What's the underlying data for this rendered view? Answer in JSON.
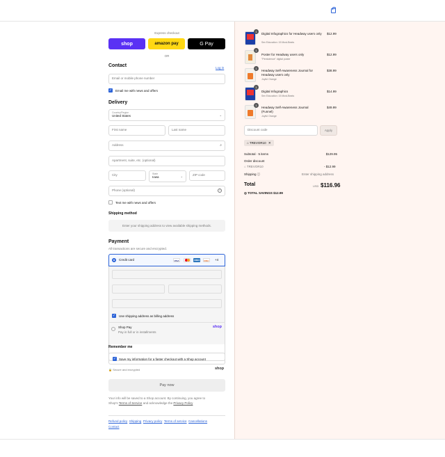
{
  "express": {
    "label": "Express checkout",
    "shop_label": "shop",
    "amazon_label": "amazon pay",
    "gpay_label": "G Pay",
    "or_label": "OR"
  },
  "contact": {
    "title": "Contact",
    "login_label": "Log in",
    "input_placeholder": "Email or mobile phone number",
    "news_label": "Email me with news and offers"
  },
  "delivery": {
    "title": "Delivery",
    "country_label": "Country/Region",
    "country_value": "United States",
    "first_name": "First name",
    "last_name": "Last name",
    "address": "Address",
    "apartment": "Apartment, suite, etc. (optional)",
    "city": "City",
    "state_label": "State",
    "state_value": "Iowa",
    "zip": "ZIP code",
    "phone": "Phone (optional)",
    "text_news_label": "Text me with news and offers"
  },
  "shipping_method": {
    "title": "Shipping method",
    "message": "Enter your shipping address to view available shipping methods."
  },
  "payment": {
    "title": "Payment",
    "subtitle": "All transactions are secure and encrypted.",
    "credit_card_label": "Credit card",
    "card_more": "+4",
    "billing_label": "Use shipping address as billing address",
    "shoppay_label": "Shop Pay",
    "shoppay_sub": "Pay in full or in installments",
    "shoppay_logo": "shop"
  },
  "remember": {
    "title": "Remember me",
    "save_label": "Save my information for a faster checkout with a Shop account",
    "secure_label": "Secure and encrypted",
    "shop_logo": "shop"
  },
  "pay_now": "Pay now",
  "disclaimer": {
    "line1": "Your info will be saved to a Shop account. By continuing, you agree to",
    "line2_a": "Shop's",
    "tos": "Terms of Service",
    "line2_b": "and acknowledge the",
    "privacy": "Privacy Policy"
  },
  "footer_links": [
    "Refund policy",
    "Shipping",
    "Privacy policy",
    "Terms of service",
    "Cancellations",
    "Contact"
  ],
  "order": {
    "items": [
      {
        "qty": "1",
        "name_1": "Digital Infographics for Headway users",
        "name_2": "only",
        "variant": "Sex Education: 15 Most-Beats",
        "price": "$12.99",
        "thumb": "book-blue"
      },
      {
        "qty": "1",
        "name_1": "Poster for Headway users only",
        "name_2": "",
        "variant": "\"Persistence\" digital poster",
        "price": "$12.99",
        "thumb": "poster"
      },
      {
        "qty": "1",
        "name_1": "Headway Self-Awareness Journal for",
        "name_2": "Headway users only",
        "variant": "Joyful Orange",
        "price": "$38.99",
        "thumb": "journal"
      },
      {
        "qty": "1",
        "name_1": "Digital Infographics",
        "name_2": "",
        "variant": "Sex Education: 15 Most-Beats",
        "price": "$14.99",
        "thumb": "book-blue"
      },
      {
        "qty": "1",
        "name_1": "Headway Self-Awareness Journal",
        "name_2": "(Funnel)",
        "variant": "Joyful Orange",
        "price": "$49.99",
        "thumb": "journal"
      }
    ],
    "discount_placeholder": "Discount code",
    "apply_label": "Apply",
    "code_tag": "TREVOR10",
    "subtotal_label": "Subtotal · 5 items",
    "subtotal_value": "$129.95",
    "order_discount_label": "Order discount",
    "discount_code": "TREVOR10",
    "discount_value": "- $12.99",
    "shipping_label": "Shipping",
    "shipping_value": "Enter shipping address",
    "total_label": "Total",
    "currency": "USD",
    "total_value": "$116.96",
    "savings_label": "TOTAL SAVINGS",
    "savings_value": "$12.99"
  },
  "colors": {
    "accent": "#2d64d8",
    "shop_purple": "#5a31f4",
    "amazon_yellow": "#ffd814",
    "right_bg": "#fff5f1"
  }
}
